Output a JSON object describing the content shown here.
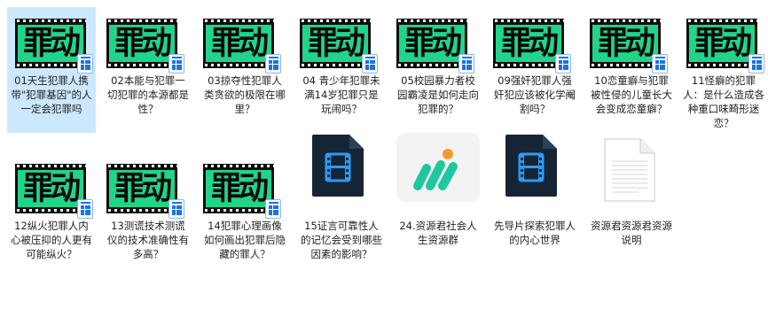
{
  "items": [
    {
      "label": "01天生犯罪人携带\"犯罪基因\"的人一定会犯罪吗",
      "icon": "video-thumbnail",
      "selected": true
    },
    {
      "label": "02本能与犯罪一切犯罪的本源都是性？",
      "icon": "video-thumbnail"
    },
    {
      "label": "03掠夺性犯罪人类贪欲的极限在哪里？",
      "icon": "video-thumbnail"
    },
    {
      "label": "04 青少年犯罪未满14岁犯罪只是玩闹吗？",
      "icon": "video-thumbnail"
    },
    {
      "label": "05校园暴力者校园霸凌是如何走向犯罪的？",
      "icon": "video-thumbnail"
    },
    {
      "label": "09强奸犯罪人强奸犯应该被化学阉割吗？",
      "icon": "video-thumbnail"
    },
    {
      "label": "10恋童癖与犯罪被性侵的儿童长大会变成恋童癖？",
      "icon": "video-thumbnail"
    },
    {
      "label": "11怪癖的犯罪人：是什么造成各种重口味畸形迷恋？",
      "icon": "video-thumbnail"
    },
    {
      "label": "12纵火犯罪人内心被压抑的人更有可能纵火？",
      "icon": "video-thumbnail"
    },
    {
      "label": "13测谎技术测谎仪的技术准确性有多高？",
      "icon": "video-thumbnail"
    },
    {
      "label": "14犯罪心理画像如何画出犯罪后隐藏的罪人？",
      "icon": "video-thumbnail"
    },
    {
      "label": "15证言可靠性人的记忆会受到哪些因素的影响？",
      "icon": "video-file-dark"
    },
    {
      "label": "24.资源君社会人生资源群",
      "icon": "app-logo"
    },
    {
      "label": "先导片探索犯罪人的内心世界",
      "icon": "video-file-dark"
    },
    {
      "label": "资源君资源君资源说明",
      "icon": "text-document"
    }
  ],
  "thumb_text": "罪动",
  "colors": {
    "thumb_green": "#20d58a",
    "selection": "#cce8ff",
    "dark_file": "#162536",
    "dark_file_accent": "#2b9bf4",
    "app_green": "#1fc7a0",
    "app_orange": "#f59a32"
  }
}
